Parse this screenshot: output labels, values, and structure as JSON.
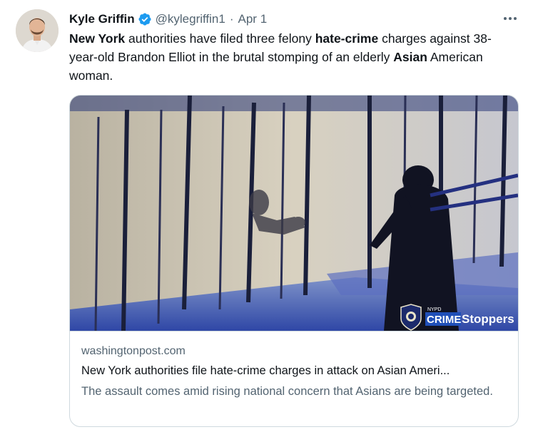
{
  "author": {
    "name": "Kyle Griffin",
    "handle": "@kylegriffin1",
    "separator": "·",
    "date": "Apr 1"
  },
  "tweet": {
    "segments": [
      {
        "text": "New York",
        "bold": true
      },
      {
        "text": " authorities have filed three felony ",
        "bold": false
      },
      {
        "text": "hate-crime",
        "bold": true
      },
      {
        "text": " charges against 38-year-old Brandon Elliot in the brutal stomping of an elderly ",
        "bold": false
      },
      {
        "text": "Asian",
        "bold": true
      },
      {
        "text": " American woman.",
        "bold": false
      }
    ]
  },
  "card": {
    "domain": "washingtonpost.com",
    "title": "New York authorities file hate-crime charges in attack on Asian Ameri...",
    "description": "The assault comes amid rising national concern that Asians are being targeted.",
    "overlay": {
      "top_label": "NYPD",
      "crime": "CRIME",
      "stoppers": "Stoppers"
    }
  },
  "colors": {
    "accent": "#1d9bf0",
    "secondary_text": "#536471",
    "border": "#cfd9de"
  },
  "icons": [
    "verified-badge-icon",
    "more-options-icon",
    "nypd-badge-icon"
  ]
}
